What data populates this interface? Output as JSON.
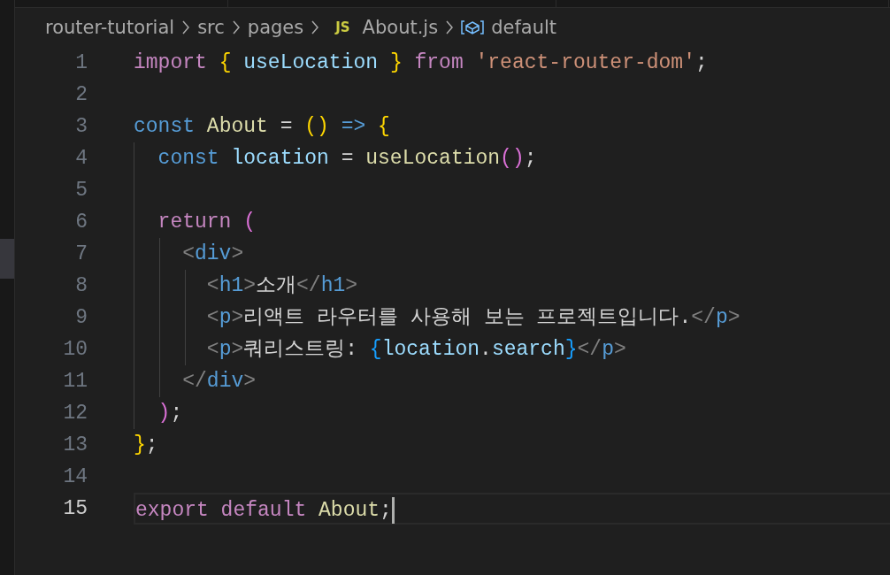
{
  "breadcrumb": [
    {
      "kind": "folder",
      "label": "router-tutorial"
    },
    {
      "kind": "folder",
      "label": "src"
    },
    {
      "kind": "folder",
      "label": "pages"
    },
    {
      "kind": "file",
      "badge": "JS",
      "label": "About.js"
    },
    {
      "kind": "symbol",
      "label": "default"
    }
  ],
  "lines": [
    {
      "number": "1",
      "selected": false,
      "tokens": [
        {
          "t": "import ",
          "color": "#c586c0"
        },
        {
          "t": "{",
          "color": "#ffd700"
        },
        {
          "t": " useLocation ",
          "color": "#9cdcfe"
        },
        {
          "t": "}",
          "color": "#ffd700"
        },
        {
          "t": " from ",
          "color": "#c586c0"
        },
        {
          "t": "'react-router-dom'",
          "color": "#ce9178"
        },
        {
          "t": ";",
          "color": "#d4d4d4"
        }
      ]
    },
    {
      "number": "2",
      "selected": false
    },
    {
      "number": "3",
      "selected": false,
      "tokens": [
        {
          "t": "const ",
          "color": "#569cd6"
        },
        {
          "t": "About",
          "color": "#dcdcaa"
        },
        {
          "t": " = ",
          "color": "#d4d4d4"
        },
        {
          "t": "()",
          "color": "#ffd700"
        },
        {
          "t": " => ",
          "color": "#569cd6"
        },
        {
          "t": "{",
          "color": "#ffd700"
        }
      ]
    },
    {
      "number": "4",
      "selected": false,
      "tokens": [
        {
          "t": "  const ",
          "color": "#569cd6"
        },
        {
          "t": "location",
          "color": "#9cdcfe"
        },
        {
          "t": " = ",
          "color": "#d4d4d4"
        },
        {
          "t": "useLocation",
          "color": "#dcdcaa"
        },
        {
          "t": "()",
          "color": "#da70d6"
        },
        {
          "t": ";",
          "color": "#d4d4d4"
        }
      ]
    },
    {
      "number": "5",
      "selected": false
    },
    {
      "number": "6",
      "selected": false,
      "tokens": [
        {
          "t": "  return ",
          "color": "#c586c0"
        },
        {
          "t": "(",
          "color": "#da70d6"
        }
      ]
    },
    {
      "number": "7",
      "selected": false,
      "tokens": [
        {
          "t": "    <",
          "color": "#808080"
        },
        {
          "t": "div",
          "color": "#569cd6"
        },
        {
          "t": ">",
          "color": "#808080"
        }
      ]
    },
    {
      "number": "8",
      "selected": false,
      "tokens": [
        {
          "t": "      <",
          "color": "#808080"
        },
        {
          "t": "h1",
          "color": "#569cd6"
        },
        {
          "t": ">",
          "color": "#808080"
        },
        {
          "t": "소개",
          "color": "#d4d4d4"
        },
        {
          "t": "</",
          "color": "#808080"
        },
        {
          "t": "h1",
          "color": "#569cd6"
        },
        {
          "t": ">",
          "color": "#808080"
        }
      ]
    },
    {
      "number": "9",
      "selected": false,
      "tokens": [
        {
          "t": "      <",
          "color": "#808080"
        },
        {
          "t": "p",
          "color": "#569cd6"
        },
        {
          "t": ">",
          "color": "#808080"
        },
        {
          "t": "리액트 라우터를 사용해 보는 프로젝트입니다.",
          "color": "#d4d4d4"
        },
        {
          "t": "</",
          "color": "#808080"
        },
        {
          "t": "p",
          "color": "#569cd6"
        },
        {
          "t": ">",
          "color": "#808080"
        }
      ]
    },
    {
      "number": "10",
      "selected": false,
      "tokens": [
        {
          "t": "      <",
          "color": "#808080"
        },
        {
          "t": "p",
          "color": "#569cd6"
        },
        {
          "t": ">",
          "color": "#808080"
        },
        {
          "t": "쿼리스트링: ",
          "color": "#d4d4d4"
        },
        {
          "t": "{",
          "color": "#179fff"
        },
        {
          "t": "location",
          "color": "#9cdcfe"
        },
        {
          "t": ".",
          "color": "#d4d4d4"
        },
        {
          "t": "search",
          "color": "#9cdcfe"
        },
        {
          "t": "}",
          "color": "#179fff"
        },
        {
          "t": "</",
          "color": "#808080"
        },
        {
          "t": "p",
          "color": "#569cd6"
        },
        {
          "t": ">",
          "color": "#808080"
        }
      ]
    },
    {
      "number": "11",
      "selected": false,
      "tokens": [
        {
          "t": "    </",
          "color": "#808080"
        },
        {
          "t": "div",
          "color": "#569cd6"
        },
        {
          "t": ">",
          "color": "#808080"
        }
      ]
    },
    {
      "number": "12",
      "selected": false,
      "tokens": [
        {
          "t": "  )",
          "color": "#da70d6"
        },
        {
          "t": ";",
          "color": "#d4d4d4"
        }
      ]
    },
    {
      "number": "13",
      "selected": false,
      "tokens": [
        {
          "t": "}",
          "color": "#ffd700"
        },
        {
          "t": ";",
          "color": "#d4d4d4"
        }
      ]
    },
    {
      "number": "14",
      "selected": false
    },
    {
      "number": "15",
      "selected": true,
      "tokens": [
        {
          "t": "export default ",
          "color": "#c586c0"
        },
        {
          "t": "About",
          "color": "#dcdcaa"
        },
        {
          "t": ";",
          "color": "#d4d4d4"
        }
      ]
    }
  ]
}
